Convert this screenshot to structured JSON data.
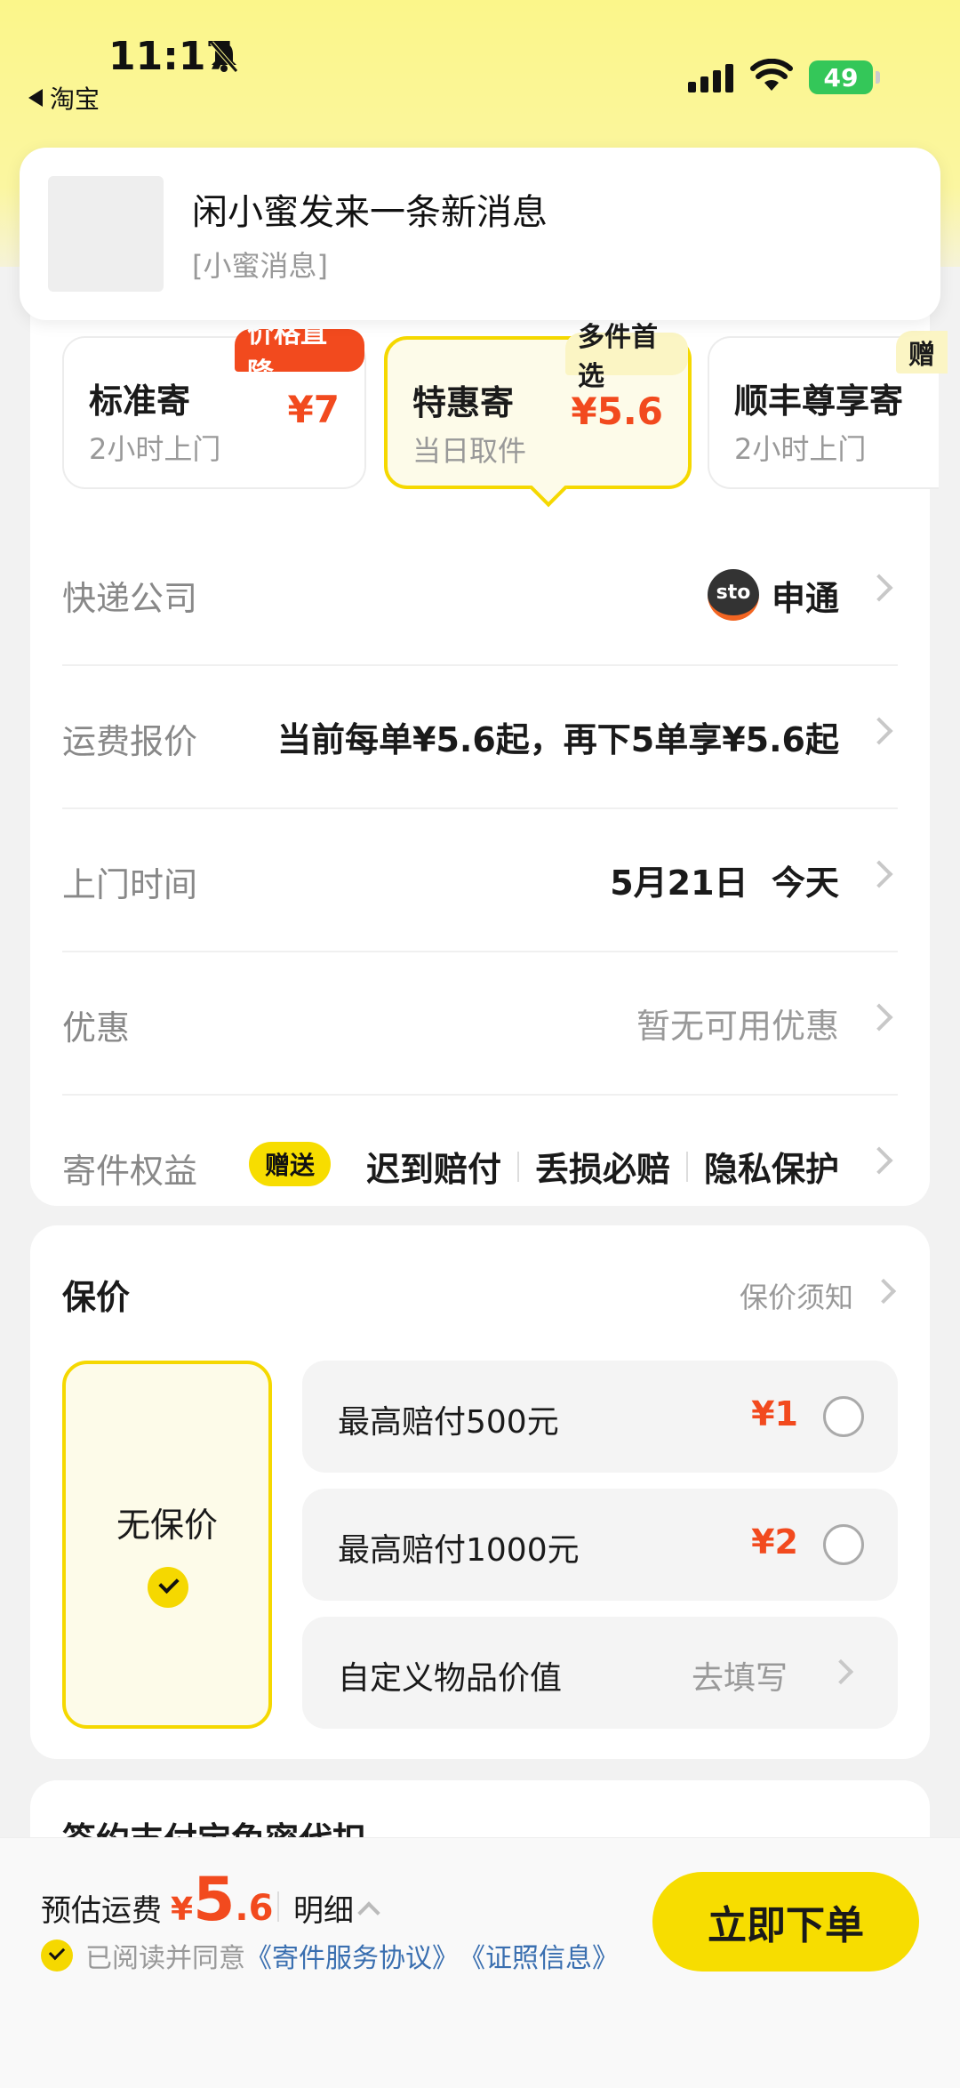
{
  "status_bar": {
    "time": "11:17",
    "back_app": "淘宝",
    "battery": "49",
    "icons": [
      "bell-slash-icon",
      "signal-icon",
      "wifi-icon",
      "battery-icon"
    ]
  },
  "notification": {
    "title": "闲小蜜发来一条新消息",
    "subtitle": "[小蜜消息]"
  },
  "shipping_options": [
    {
      "name": "标准寄",
      "sub": "2小时上门",
      "price": "¥7",
      "tag": "价格直降"
    },
    {
      "name": "特惠寄",
      "sub": "当日取件",
      "price": "¥5.6",
      "tag": "多件首选",
      "selected": true
    },
    {
      "name": "顺丰尊享寄",
      "sub": "2小时上门",
      "tag": "赠"
    }
  ],
  "rows": {
    "courier": {
      "label": "快递公司",
      "logo_text": "sto",
      "value": "申通"
    },
    "quote": {
      "label": "运费报价",
      "value": "当前每单¥5.6起，再下5单享¥5.6起"
    },
    "pickup": {
      "label": "上门时间",
      "value": "5月21日  今天"
    },
    "discount": {
      "label": "优惠",
      "value": "暂无可用优惠"
    },
    "benefits": {
      "label": "寄件权益",
      "badge": "赠送",
      "items": [
        "迟到赔付",
        "丢损必赔",
        "隐私保护"
      ]
    }
  },
  "insurance": {
    "title": "保价",
    "notice_link": "保价须知",
    "none_label": "无保价",
    "options": [
      {
        "label": "最高赔付500元",
        "price": "¥1"
      },
      {
        "label": "最高赔付1000元",
        "price": "¥2"
      },
      {
        "label": "自定义物品价值",
        "link": "去填写"
      }
    ]
  },
  "next_section_title": "签约支付宝免密代扣",
  "bottom_bar": {
    "fee_label": "预估运费",
    "currency": "¥",
    "amount_int": "5",
    "amount_dec": ".6",
    "detail": "明细",
    "agree_text": "已阅读并同意",
    "agreement_link": "《寄件服务协议》",
    "license_link": "《证照信息》",
    "order_button": "立即下单"
  },
  "colors": {
    "accent_yellow": "#f7dd00",
    "price_red": "#f24a1e",
    "link_blue": "#3a6fb0"
  }
}
